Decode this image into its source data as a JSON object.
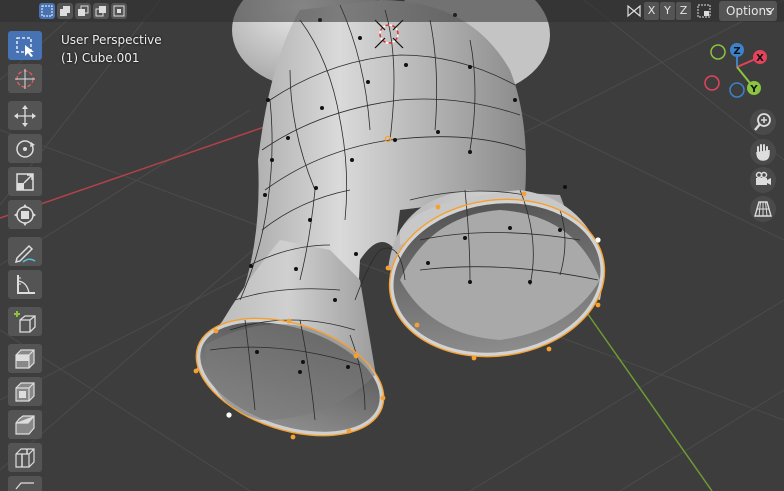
{
  "viewport": {
    "view_name": "User Perspective",
    "object_name": "(1) Cube.001"
  },
  "header": {
    "select_modes": [
      "select-new-icon",
      "select-extend-icon",
      "select-subtract-icon",
      "select-invert-icon",
      "select-intersect-icon"
    ],
    "axis_buttons": [
      "X",
      "Y",
      "Z"
    ],
    "options_label": "Options"
  },
  "toolbar": {
    "tools": [
      "select-box-icon",
      "cursor-icon",
      "move-icon",
      "rotate-icon",
      "scale-icon",
      "transform-icon",
      "annotate-icon",
      "measure-icon",
      "add-cube-icon",
      "extrude-icon",
      "inset-icon",
      "bevel-icon",
      "loop-cut-icon"
    ]
  },
  "gizmo": {
    "x_label": "X",
    "y_label": "Y",
    "z_label": "Z",
    "colors": {
      "x": "#e2445c",
      "y": "#8bc53f",
      "z": "#3c83ce"
    }
  },
  "nav_buttons": [
    "zoom-icon",
    "pan-hand-icon",
    "camera-icon",
    "grid-ortho-icon"
  ],
  "colors": {
    "background": "#3d3d3d",
    "active_tool": "#4772b3",
    "selected_edge": "#f5a030"
  }
}
